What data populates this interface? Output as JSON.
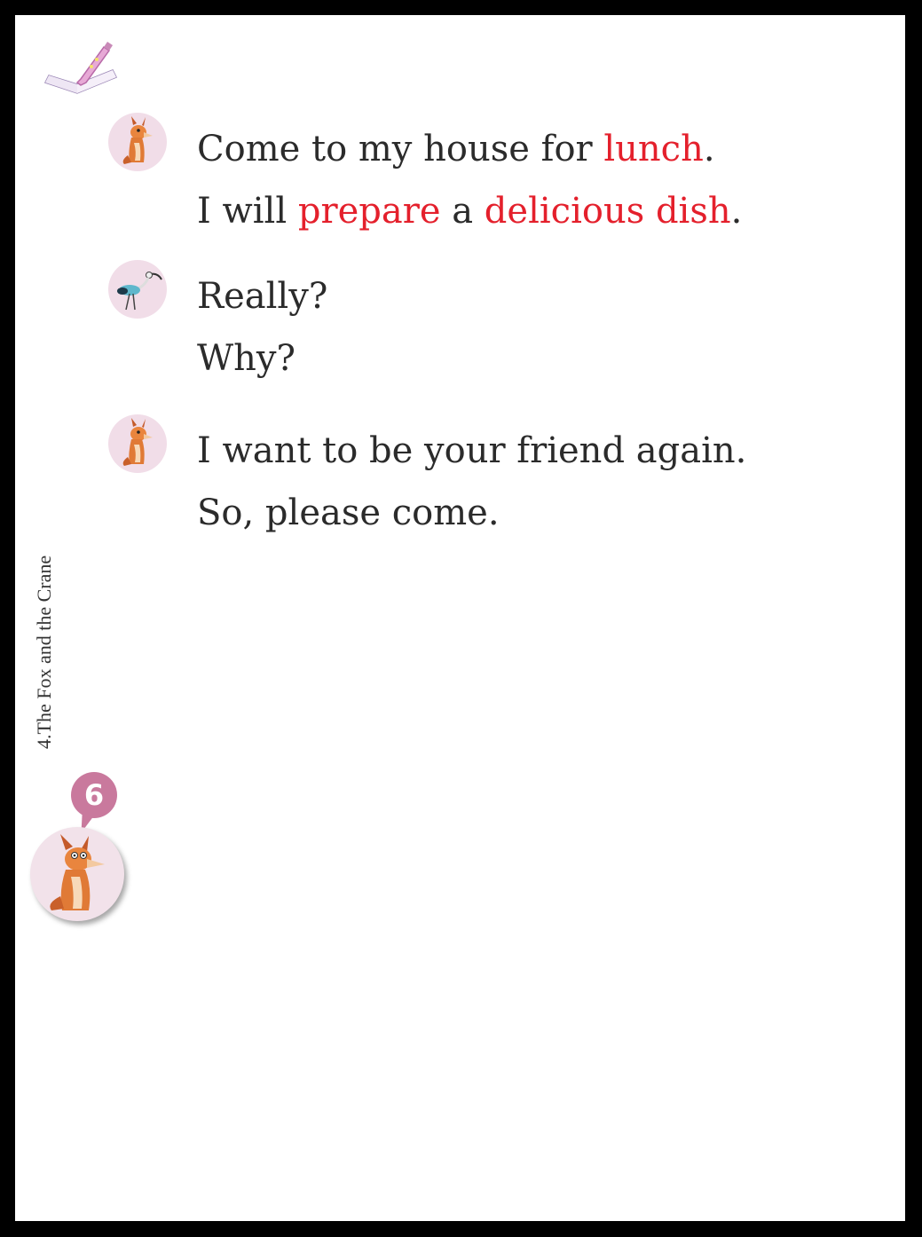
{
  "chapter_title": "4.The Fox and the Crane",
  "page_badge": "6",
  "dialog": [
    {
      "speaker_icon": "fox-icon",
      "lines": [
        [
          {
            "t": "Come to my house for "
          },
          {
            "t": "lunch",
            "hl": true
          },
          {
            "t": "."
          }
        ],
        [
          {
            "t": "I will "
          },
          {
            "t": "prepare",
            "hl": true
          },
          {
            "t": " a "
          },
          {
            "t": "delicious dish",
            "hl": true
          },
          {
            "t": "."
          }
        ]
      ]
    },
    {
      "speaker_icon": "crane-icon",
      "lines": [
        [
          {
            "t": "Really?"
          }
        ],
        [
          {
            "t": "Why?"
          }
        ]
      ]
    },
    {
      "speaker_icon": "fox-icon",
      "lines": [
        [
          {
            "t": "I want to be your friend again."
          }
        ],
        [
          {
            "t": "So, please come."
          }
        ]
      ]
    }
  ],
  "colors": {
    "highlight": "#e4202c",
    "text": "#2b2b2b",
    "badge": "#c9799d",
    "avatar_bg": "#f1dde8"
  }
}
